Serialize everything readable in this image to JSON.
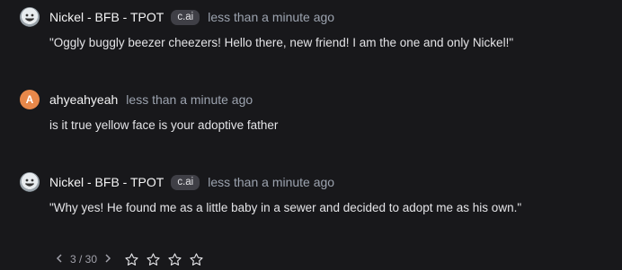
{
  "messages": [
    {
      "author": "Nickel - BFB - TPOT",
      "badge": "c.ai",
      "time": "less than a minute ago",
      "text": "\"Oggly buggly beezer cheezers! Hello there, new friend! I am the one and only Nickel!\"",
      "avatar_icon": "smiling-character-avatar"
    },
    {
      "author": "ahyeahyeah",
      "time": "less than a minute ago",
      "text": "is it true yellow face is your adoptive father",
      "avatar_letter": "A",
      "avatar_color": "#e8884a"
    },
    {
      "author": "Nickel - BFB - TPOT",
      "badge": "c.ai",
      "time": "less than a minute ago",
      "text": "\"Why yes! He found me as a little baby in a sewer and decided to adopt me as his own.\"",
      "avatar_icon": "smiling-character-avatar"
    }
  ],
  "footer": {
    "prev_icon": "chevron-left-icon",
    "pager": "3 / 30",
    "next_icon": "chevron-right-icon",
    "rating_stars": 4,
    "rating_value": 0
  },
  "colors": {
    "background": "#18181b",
    "badge_bg": "#3f3f46",
    "muted_text": "#9ca3af"
  }
}
